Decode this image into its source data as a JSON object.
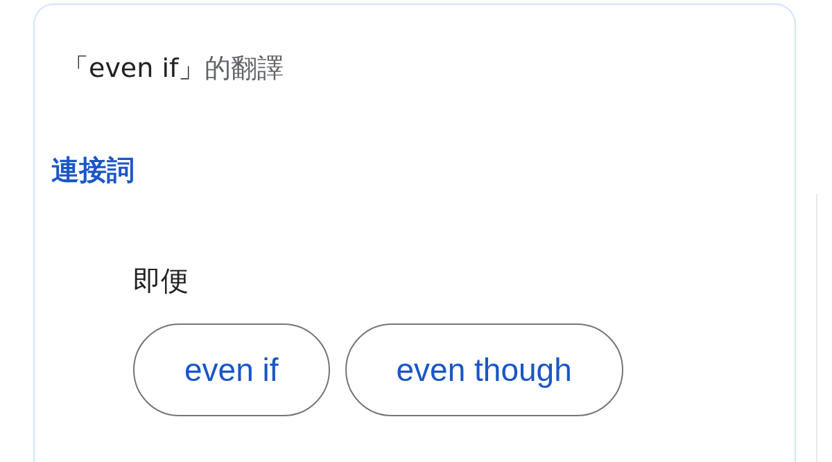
{
  "title": {
    "term": "「even if」",
    "suffix": "的翻譯"
  },
  "sections": [
    {
      "part_of_speech": "連接詞",
      "entries": [
        {
          "translation": "即便",
          "synonyms": [
            "even if",
            "even though"
          ]
        }
      ]
    }
  ]
}
